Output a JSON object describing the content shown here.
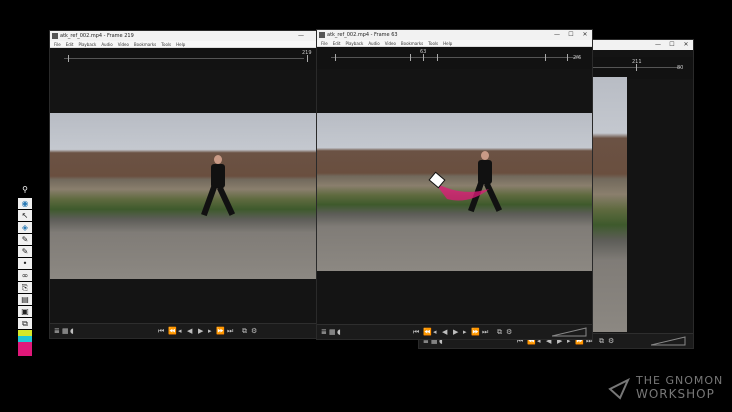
{
  "menu_items": [
    "File",
    "Edit",
    "Playback",
    "Audio",
    "Video",
    "Bookmarks",
    "Tools",
    "Help"
  ],
  "windows": [
    {
      "title": "atk_ref_002.mp4 - Frame 219",
      "frame_label": "219",
      "minimize": "—",
      "maximize": "☐",
      "close": "✕"
    },
    {
      "title": "atk_ref_002.mp4 - Frame 63",
      "frame_label": "63",
      "end_label": "2f6",
      "minimize": "—",
      "maximize": "☐",
      "close": "✕"
    },
    {
      "title": "",
      "frame_label": "211",
      "end_label": "80",
      "minimize": "—",
      "maximize": "☐",
      "close": "✕"
    }
  ],
  "controls": {
    "list_icon": "≣",
    "grid_icon": "▦",
    "speaker_icon": "◖",
    "to_start": "⏮",
    "step_back": "⏪",
    "back_frame": "◂",
    "play_back": "◀",
    "play": "▶",
    "fwd_frame": "▸",
    "step_fwd": "⏩",
    "to_end": "⏭",
    "loop_icon": "⧉",
    "settings_icon": "⚙"
  },
  "tools": {
    "pin": "⚲",
    "eye": "◉",
    "cursor": "↖",
    "eraser": "◈",
    "pencil": "✎",
    "dot": "•",
    "link": "∞",
    "clipboard": "⎘",
    "cart": "▤",
    "save": "▣",
    "copy": "⧉"
  },
  "colors": {
    "primary": "#e0187a",
    "secondary": "#d6e82a",
    "tertiary": "#21c7d6"
  },
  "logo": {
    "line1": "THE GNOMON",
    "line2": "WORKSHOP"
  }
}
